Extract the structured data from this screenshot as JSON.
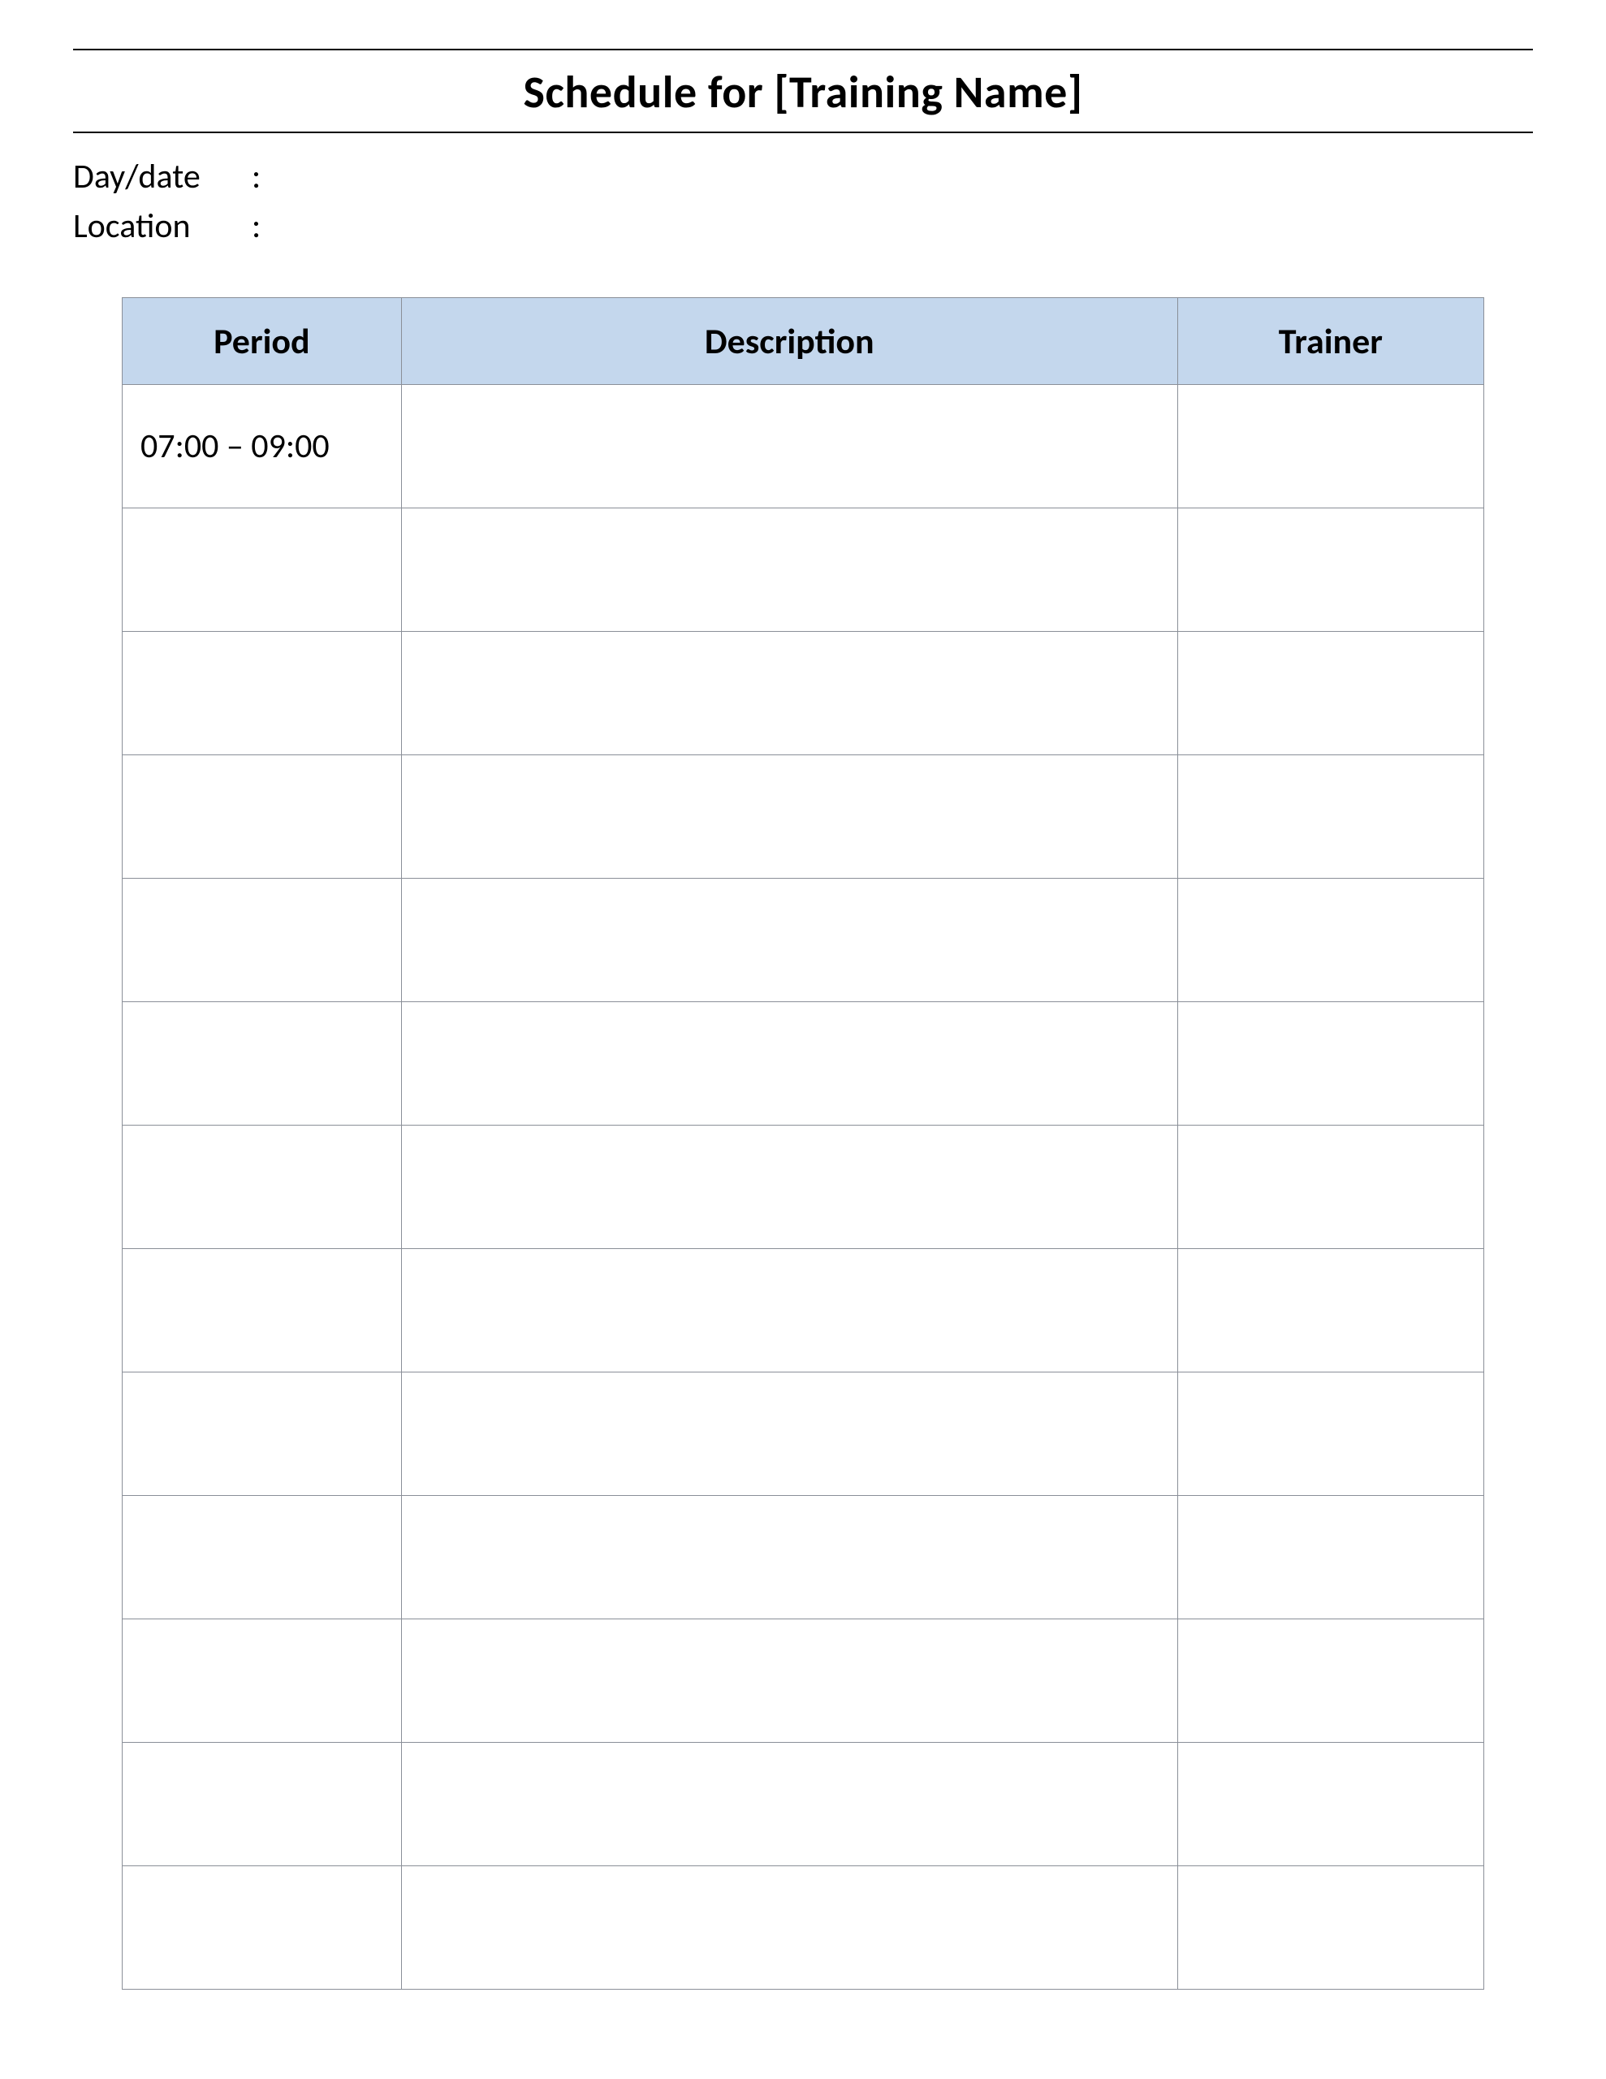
{
  "title": "Schedule for [Training Name]",
  "meta": {
    "daydate_label": "Day/date",
    "daydate_value": "",
    "location_label": "Location",
    "location_value": "",
    "colon": ":"
  },
  "table": {
    "headers": {
      "period": "Period",
      "description": "Description",
      "trainer": "Trainer"
    },
    "rows": [
      {
        "period": "07:00 – 09:00",
        "description": "",
        "trainer": ""
      },
      {
        "period": "",
        "description": "",
        "trainer": ""
      },
      {
        "period": "",
        "description": "",
        "trainer": ""
      },
      {
        "period": "",
        "description": "",
        "trainer": ""
      },
      {
        "period": "",
        "description": "",
        "trainer": ""
      },
      {
        "period": "",
        "description": "",
        "trainer": ""
      },
      {
        "period": "",
        "description": "",
        "trainer": ""
      },
      {
        "period": "",
        "description": "",
        "trainer": ""
      },
      {
        "period": "",
        "description": "",
        "trainer": ""
      },
      {
        "period": "",
        "description": "",
        "trainer": ""
      },
      {
        "period": "",
        "description": "",
        "trainer": ""
      },
      {
        "period": "",
        "description": "",
        "trainer": ""
      },
      {
        "period": "",
        "description": "",
        "trainer": ""
      }
    ]
  }
}
